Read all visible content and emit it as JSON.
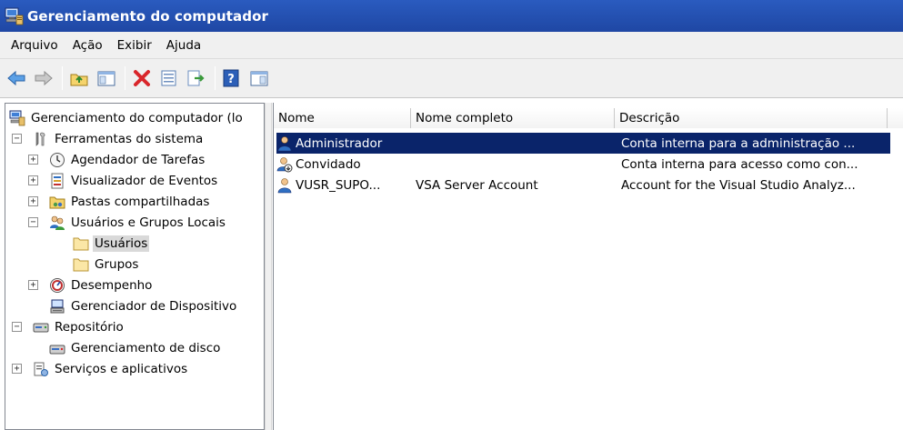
{
  "window": {
    "title": "Gerenciamento do computador",
    "app_icon": "computer-management-icon"
  },
  "menu": {
    "items": [
      "Arquivo",
      "Ação",
      "Exibir",
      "Ajuda"
    ]
  },
  "toolbar": {
    "buttons": [
      "back-arrow-icon",
      "forward-arrow-icon",
      "up-folder-icon",
      "show-hide-tree-icon",
      "delete-icon",
      "properties-icon",
      "export-list-icon",
      "help-icon",
      "show-hide-action-pane-icon"
    ]
  },
  "tree": {
    "items": [
      {
        "label": "Gerenciamento do computador (lo",
        "icon": "computer-management-icon",
        "expander": ""
      },
      {
        "label": "Ferramentas do sistema",
        "icon": "tools-icon",
        "expander": "−"
      },
      {
        "label": "Agendador de Tarefas",
        "icon": "clock-icon",
        "expander": "+"
      },
      {
        "label": "Visualizador de Eventos",
        "icon": "event-viewer-icon",
        "expander": "+"
      },
      {
        "label": "Pastas compartilhadas",
        "icon": "shared-folder-icon",
        "expander": "+"
      },
      {
        "label": "Usuários e Grupos Locais",
        "icon": "users-groups-icon",
        "expander": "−"
      },
      {
        "label": "Usuários",
        "icon": "folder-icon",
        "expander": "",
        "selected": true
      },
      {
        "label": "Grupos",
        "icon": "folder-icon",
        "expander": ""
      },
      {
        "label": "Desempenho",
        "icon": "performance-icon",
        "expander": "+"
      },
      {
        "label": "Gerenciador de Dispositivo",
        "icon": "device-manager-icon",
        "expander": ""
      },
      {
        "label": "Repositório",
        "icon": "storage-icon",
        "expander": "−"
      },
      {
        "label": "Gerenciamento de disco",
        "icon": "disk-management-icon",
        "expander": ""
      },
      {
        "label": "Serviços e aplicativos",
        "icon": "services-icon",
        "expander": "+"
      }
    ]
  },
  "list": {
    "columns": [
      "Nome",
      "Nome completo",
      "Descrição"
    ],
    "rows": [
      {
        "name": "Administrador",
        "full_name": "",
        "description": "Conta interna para a administração ...",
        "icon": "user-icon",
        "selected": true
      },
      {
        "name": "Convidado",
        "full_name": "",
        "description": "Conta interna para acesso como con...",
        "icon": "disabled-user-icon",
        "selected": false
      },
      {
        "name": "VUSR_SUPO...",
        "full_name": "VSA Server Account",
        "description": "Account for the Visual Studio Analyz...",
        "icon": "user-icon",
        "selected": false
      }
    ]
  },
  "colors": {
    "title_bar": "#1f47a4",
    "selection": "#0a246a",
    "tree_selection": "#d9d9d9"
  }
}
